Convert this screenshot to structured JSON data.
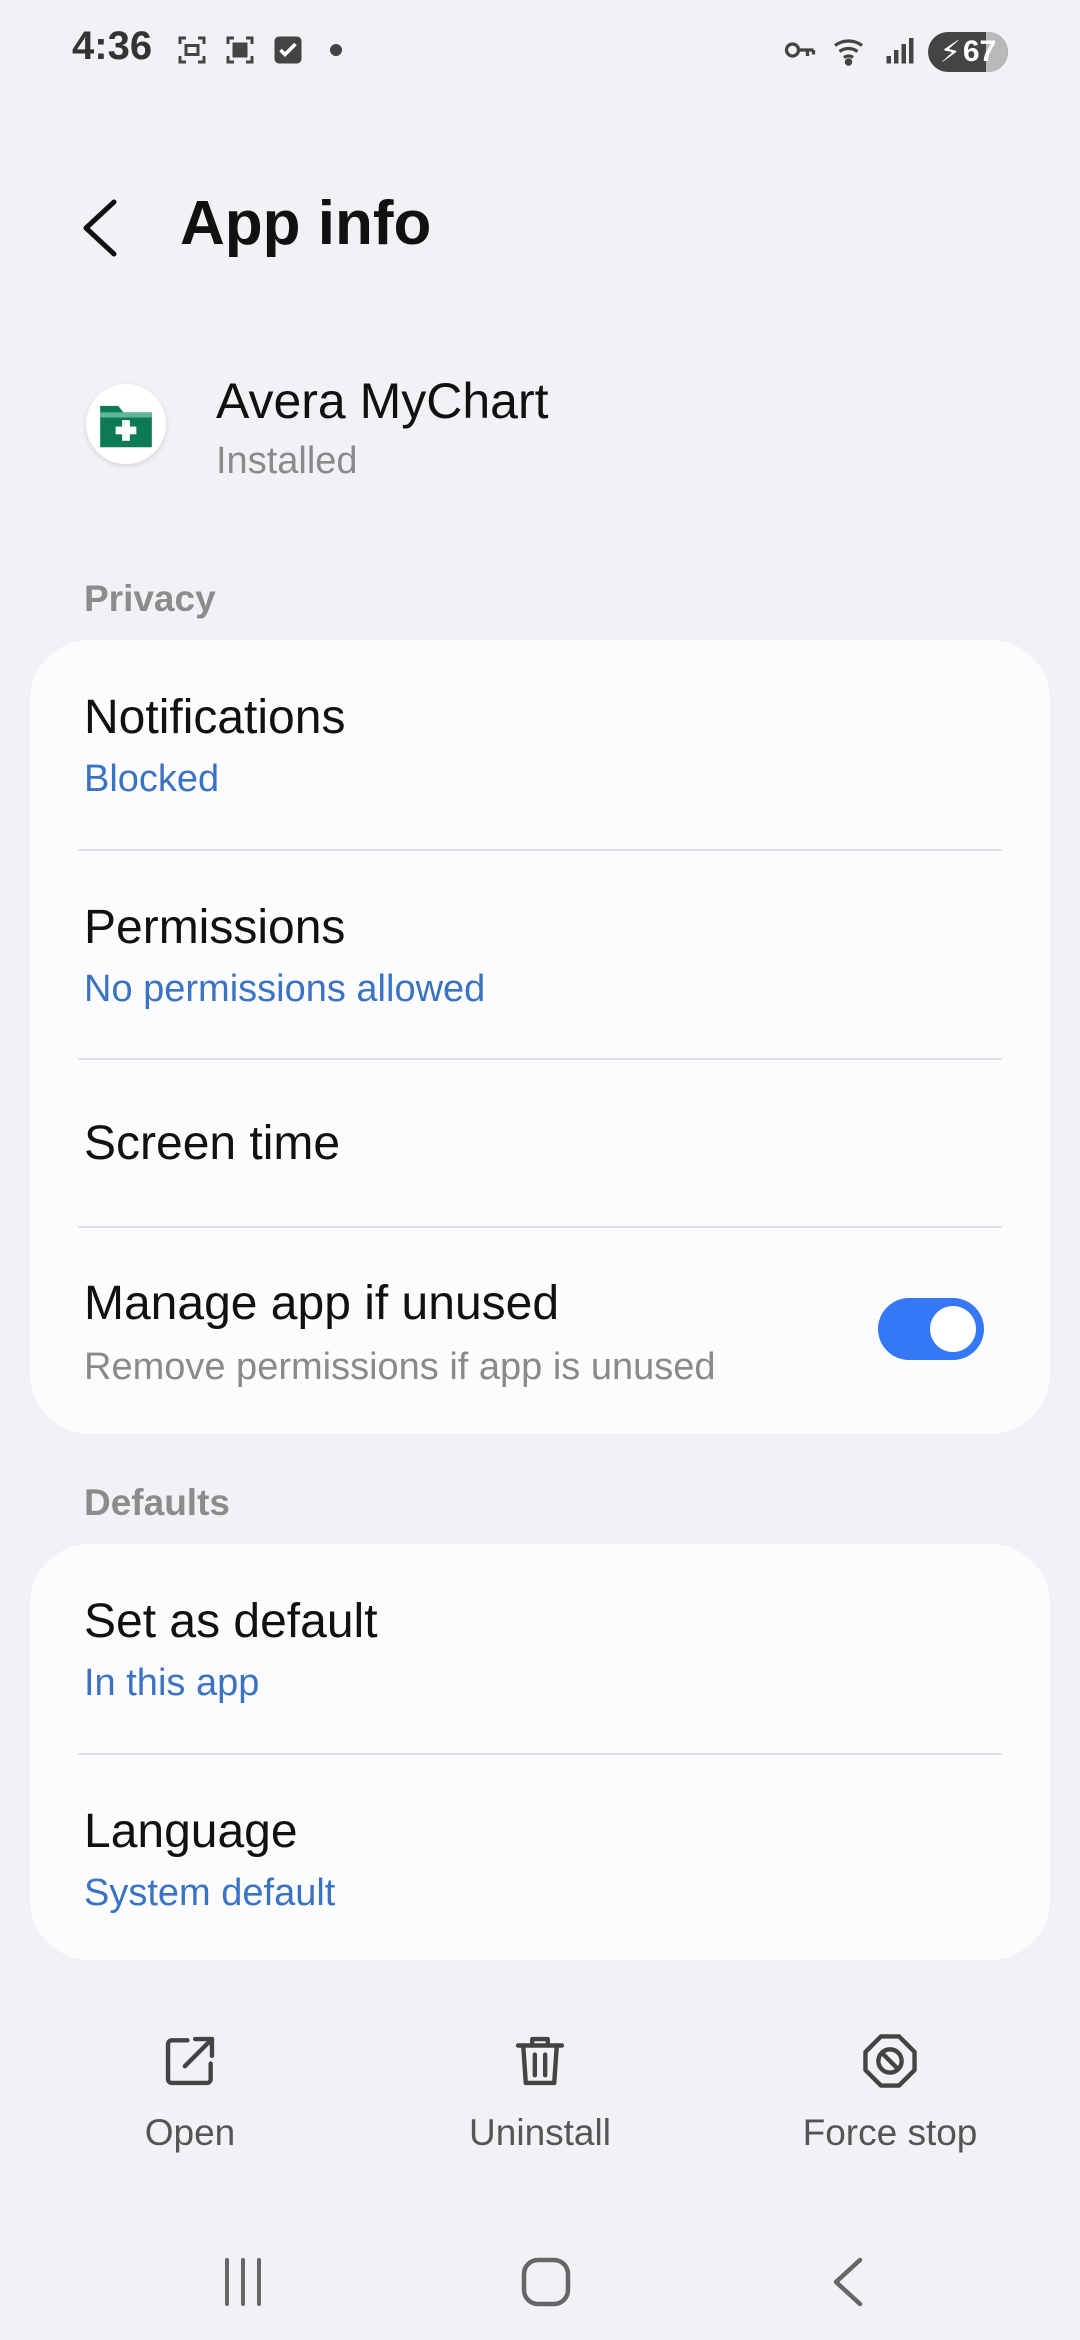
{
  "status_bar": {
    "time": "4:36",
    "battery": "67"
  },
  "header": {
    "title": "App info"
  },
  "app": {
    "name": "Avera MyChart",
    "status": "Installed",
    "icon_color": "#0e7a54"
  },
  "sections": {
    "privacy_label": "Privacy",
    "defaults_label": "Defaults"
  },
  "privacy": {
    "notifications": {
      "title": "Notifications",
      "value": "Blocked"
    },
    "permissions": {
      "title": "Permissions",
      "value": "No permissions allowed"
    },
    "screen_time": {
      "title": "Screen time"
    },
    "manage_unused": {
      "title": "Manage app if unused",
      "subtitle": "Remove permissions if app is unused",
      "enabled": true
    }
  },
  "defaults": {
    "set_default": {
      "title": "Set as default",
      "value": "In this app"
    },
    "language": {
      "title": "Language",
      "value": "System default"
    }
  },
  "actions": {
    "open": "Open",
    "uninstall": "Uninstall",
    "force_stop": "Force stop"
  },
  "colors": {
    "accent": "#3478f6",
    "link": "#3b73c4",
    "background": "#f2f2f6"
  }
}
